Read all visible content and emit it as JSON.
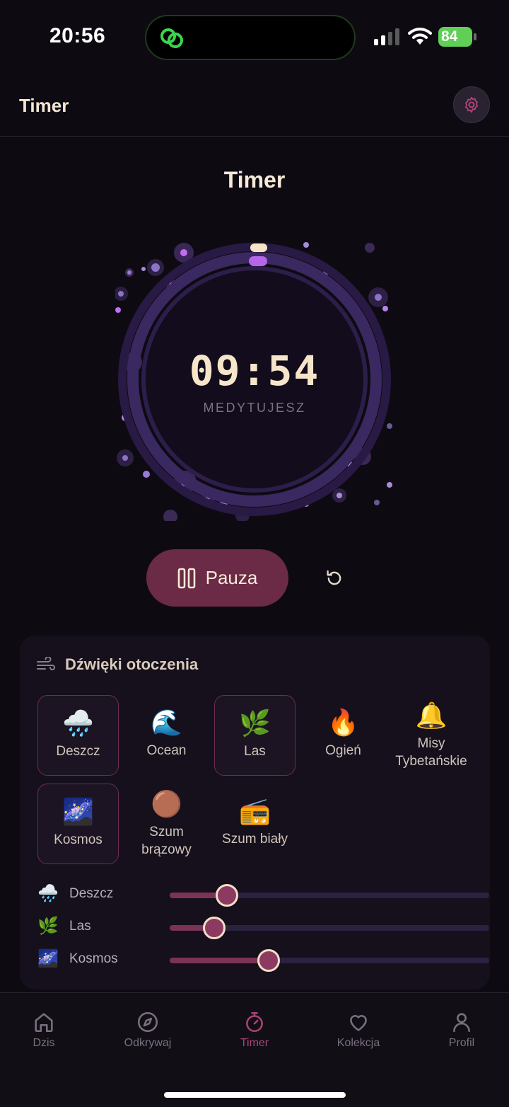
{
  "status_bar": {
    "time": "20:56",
    "battery": "84",
    "island_icon": "link-icon"
  },
  "header": {
    "title": "Timer",
    "settings_icon": "gear-icon"
  },
  "screen_title": "Timer",
  "timer": {
    "value": "09:54",
    "status": "MEDYTUJESZ",
    "accent": "#b566e8"
  },
  "controls": {
    "pause_label": "Pauza",
    "pause_icon": "pause-icon",
    "reset_icon": "reset-icon"
  },
  "ambient": {
    "title": "Dźwięki otoczenia",
    "title_icon": "wind-icon",
    "sounds": [
      {
        "emoji": "🌧️",
        "label": "Deszcz",
        "active": true
      },
      {
        "emoji": "🌊",
        "label": "Ocean",
        "active": false
      },
      {
        "emoji": "🌿",
        "label": "Las",
        "active": true
      },
      {
        "emoji": "🔥",
        "label": "Ogień",
        "active": false
      },
      {
        "emoji": "🔔",
        "label": "Misy Tybetańskie",
        "active": false
      },
      {
        "emoji": "🌌",
        "label": "Kosmos",
        "active": true
      },
      {
        "emoji": "🟤",
        "label": "Szum brązowy",
        "active": false
      },
      {
        "emoji": "📻",
        "label": "Szum biały",
        "active": false
      }
    ],
    "mixer": [
      {
        "emoji": "🌧️",
        "label": "Deszcz",
        "volume": 0.18
      },
      {
        "emoji": "🌿",
        "label": "Las",
        "volume": 0.14
      },
      {
        "emoji": "🌌",
        "label": "Kosmos",
        "volume": 0.31
      }
    ]
  },
  "tabs": [
    {
      "label": "Dzis",
      "icon": "home-icon",
      "active": false
    },
    {
      "label": "Odkrywaj",
      "icon": "compass-icon",
      "active": false
    },
    {
      "label": "Timer",
      "icon": "stopwatch-icon",
      "active": true
    },
    {
      "label": "Kolekcja",
      "icon": "heart-icon",
      "active": false
    },
    {
      "label": "Profil",
      "icon": "user-icon",
      "active": false
    }
  ],
  "colors": {
    "background": "#0e0a12",
    "accent": "#a64476",
    "pause_button": "#6b2a45",
    "text": "#f3e6d3"
  }
}
